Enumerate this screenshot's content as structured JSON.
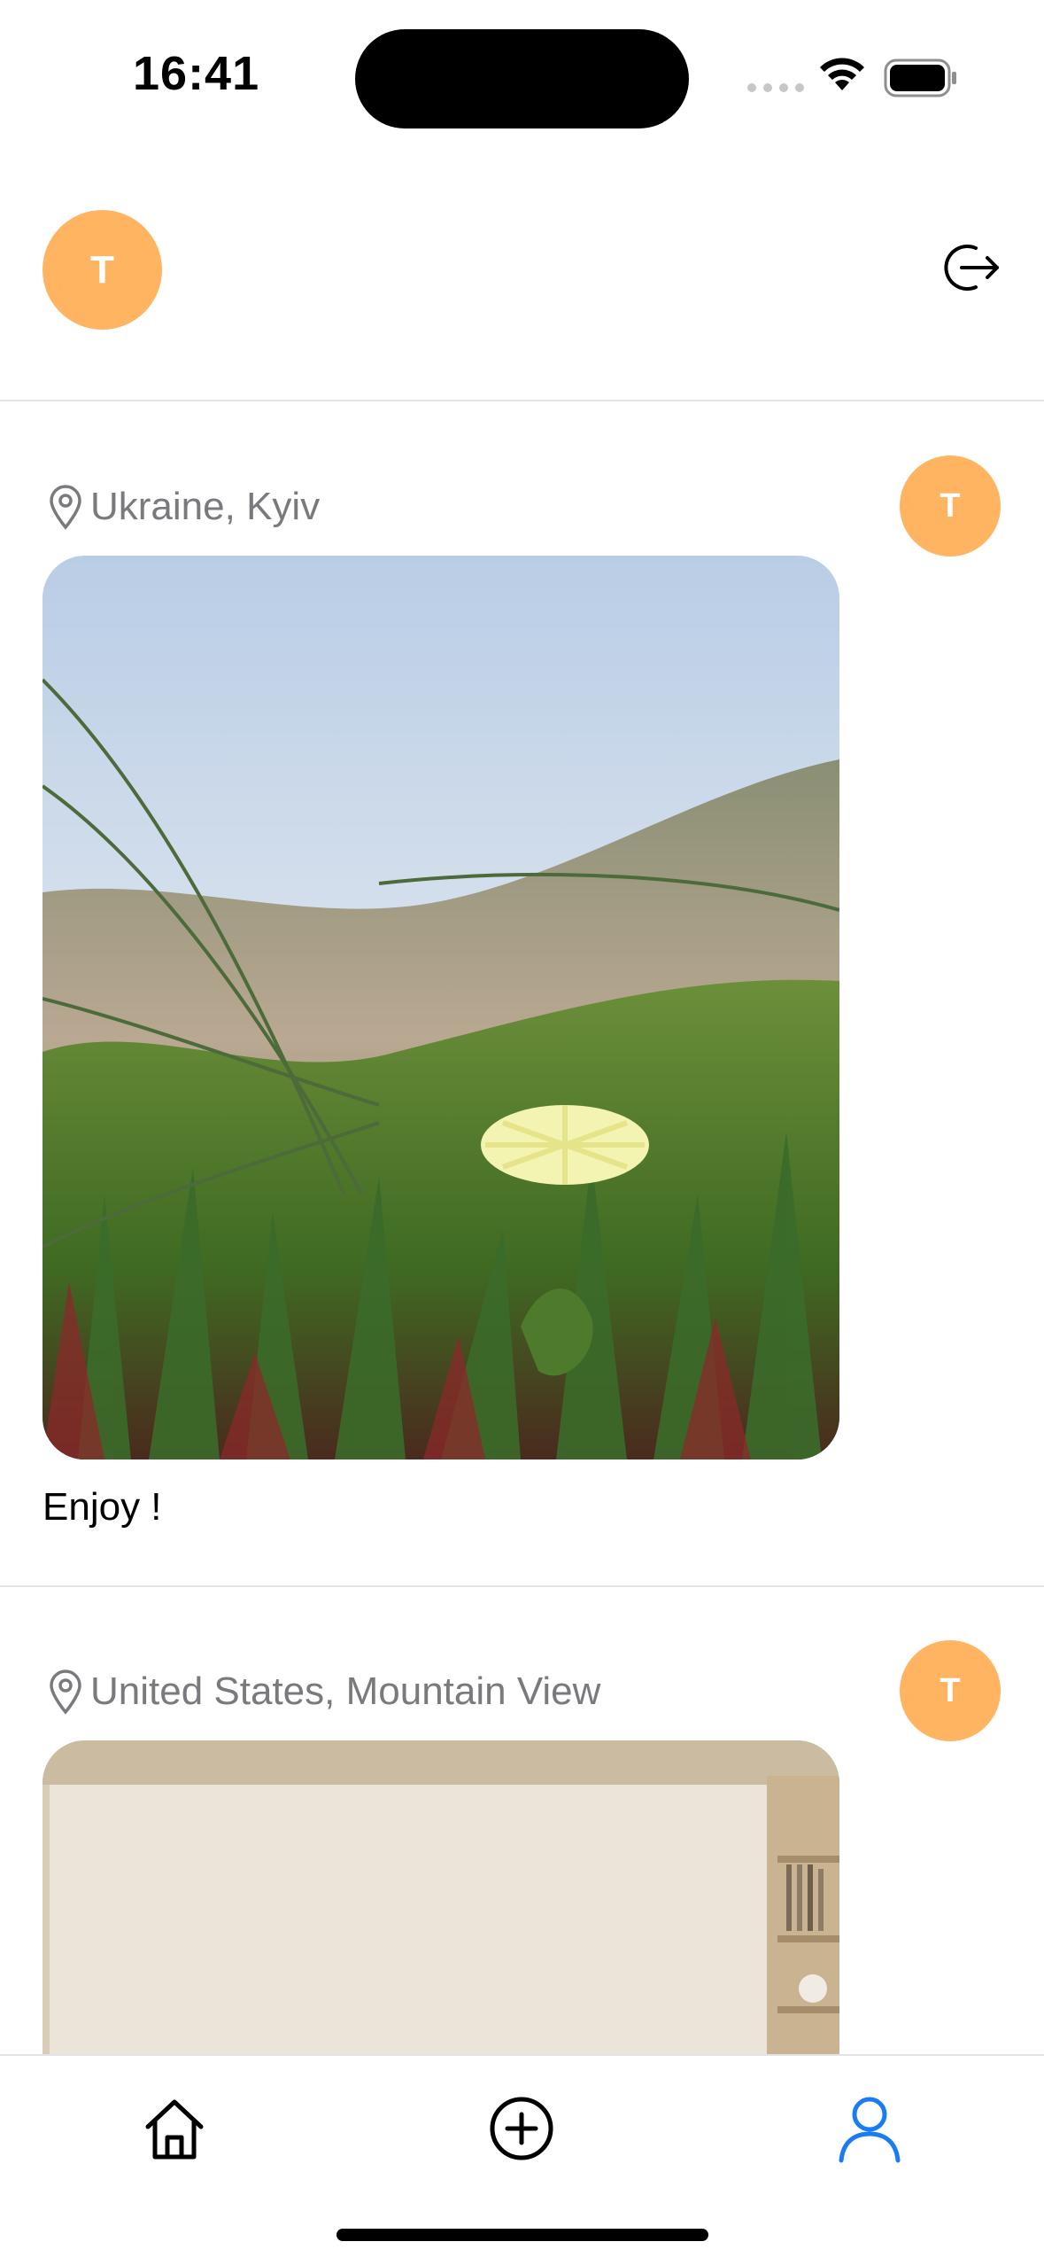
{
  "status_bar": {
    "time": "16:41"
  },
  "header": {
    "avatar_initial": "T"
  },
  "posts": [
    {
      "location": "Ukraine, Kyiv",
      "avatar_initial": "T",
      "caption": "Enjoy !"
    },
    {
      "location": "United States, Mountain View",
      "avatar_initial": "T",
      "caption": ""
    }
  ],
  "tabbar": {
    "items": [
      "home",
      "add-post",
      "profile"
    ],
    "active": "profile"
  },
  "colors": {
    "avatar": "#ffb462",
    "active_tab": "#1a7cf5",
    "secondary_text": "#7a7a7e"
  },
  "icons": [
    "location-pin-icon",
    "logout-icon",
    "home-icon",
    "plus-circle-icon",
    "person-icon",
    "wifi-icon",
    "battery-icon"
  ]
}
